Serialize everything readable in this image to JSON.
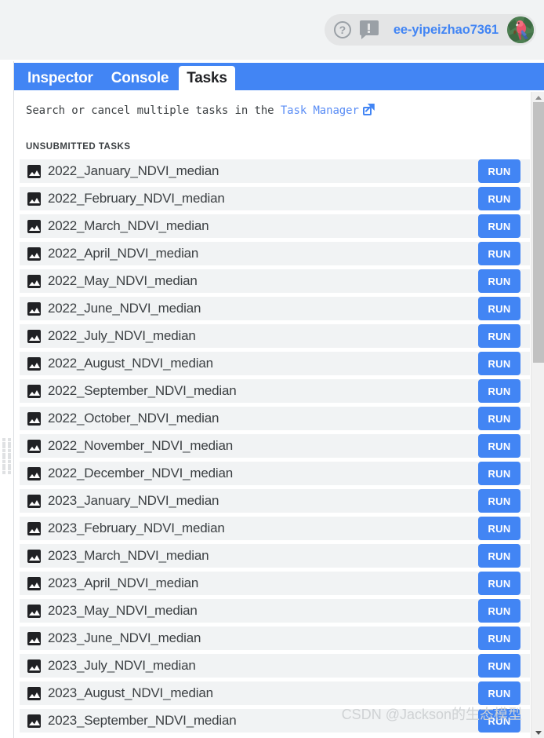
{
  "topbar": {
    "help_icon": "help-circle-icon",
    "feedback_icon": "feedback-bubble-icon",
    "account_name": "ee-yipeizhao7361",
    "avatar_icon": "parrot-avatar"
  },
  "tabs": [
    {
      "label": "Inspector",
      "active": false
    },
    {
      "label": "Console",
      "active": false
    },
    {
      "label": "Tasks",
      "active": true
    }
  ],
  "panel": {
    "description_prefix": "Search or cancel multiple tasks in the ",
    "description_link": "Task Manager",
    "external_link_icon": "external-link-icon",
    "section_label": "UNSUBMITTED TASKS",
    "run_label": "RUN",
    "task_icon": "image-icon"
  },
  "tasks": [
    {
      "name": "2022_January_NDVI_median"
    },
    {
      "name": "2022_February_NDVI_median"
    },
    {
      "name": "2022_March_NDVI_median"
    },
    {
      "name": "2022_April_NDVI_median"
    },
    {
      "name": "2022_May_NDVI_median"
    },
    {
      "name": "2022_June_NDVI_median"
    },
    {
      "name": "2022_July_NDVI_median"
    },
    {
      "name": "2022_August_NDVI_median"
    },
    {
      "name": "2022_September_NDVI_median"
    },
    {
      "name": "2022_October_NDVI_median"
    },
    {
      "name": "2022_November_NDVI_median"
    },
    {
      "name": "2022_December_NDVI_median"
    },
    {
      "name": "2023_January_NDVI_median"
    },
    {
      "name": "2023_February_NDVI_median"
    },
    {
      "name": "2023_March_NDVI_median"
    },
    {
      "name": "2023_April_NDVI_median"
    },
    {
      "name": "2023_May_NDVI_median"
    },
    {
      "name": "2023_June_NDVI_median"
    },
    {
      "name": "2023_July_NDVI_median"
    },
    {
      "name": "2023_August_NDVI_median"
    },
    {
      "name": "2023_September_NDVI_median"
    }
  ],
  "scrollbar": {
    "up_arrow_icon": "scroll-up-arrow-icon",
    "down_arrow_icon": "scroll-down-arrow-icon"
  },
  "watermark": {
    "text": "CSDN @Jackson的生态模型"
  },
  "colors": {
    "accent": "#4285f4",
    "row_bg": "#f1f3f4",
    "text": "#3c4043"
  }
}
